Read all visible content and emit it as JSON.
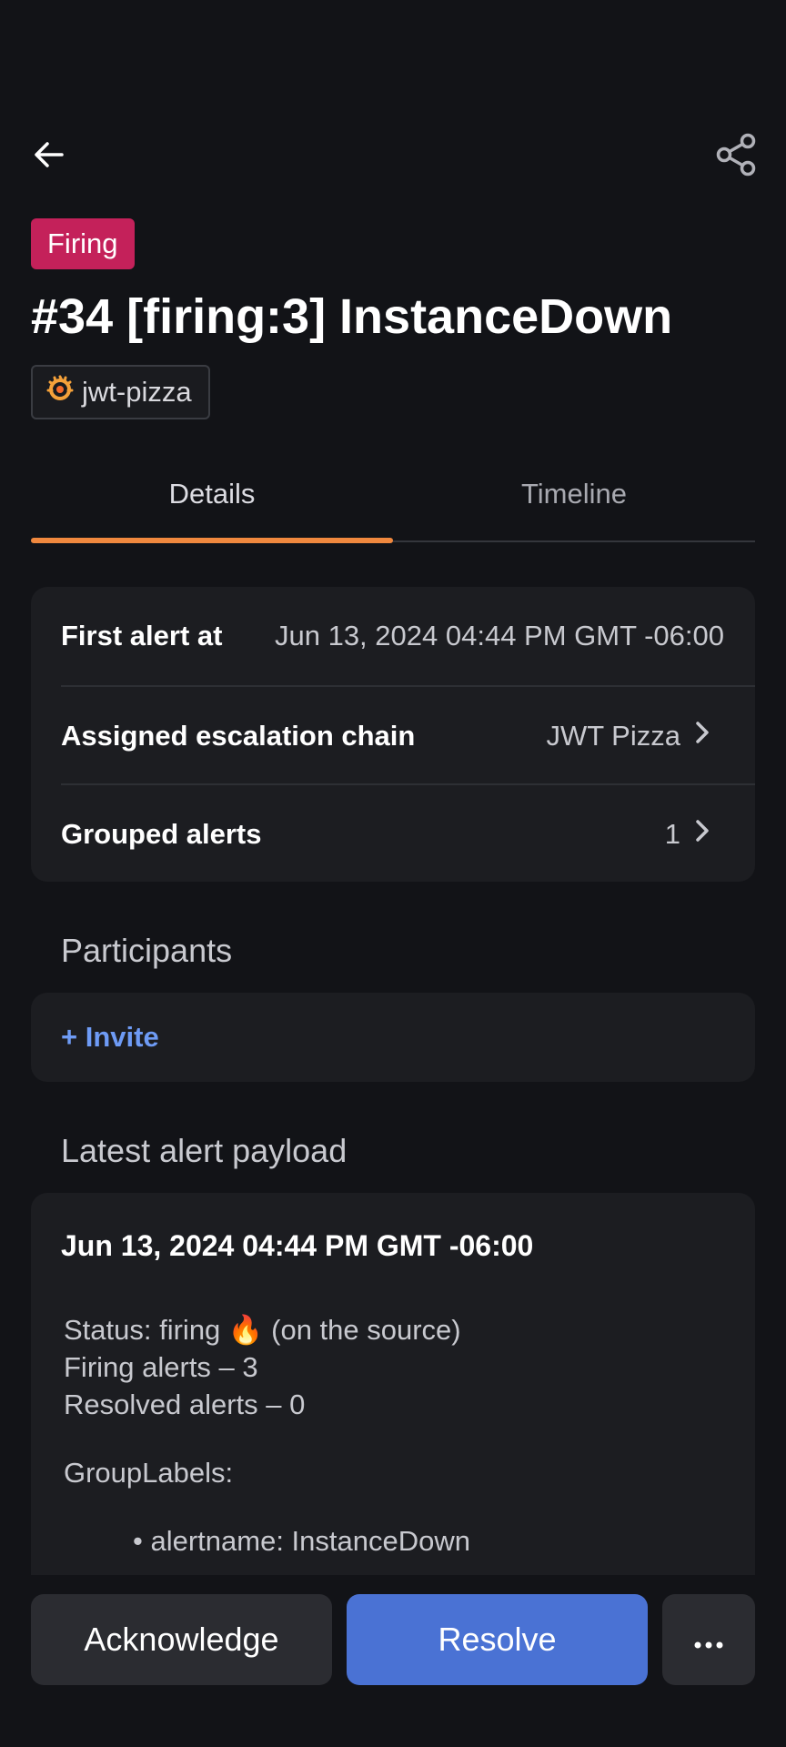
{
  "header": {
    "back_icon": "arrow-left-icon",
    "share_icon": "share-icon"
  },
  "alert": {
    "status_badge": "Firing",
    "status_color": "#c4215a",
    "title": "#34 [firing:3] InstanceDown",
    "source_icon": "grafana-icon",
    "source_name": "jwt-pizza"
  },
  "tabs": [
    {
      "label": "Details",
      "active": true
    },
    {
      "label": "Timeline",
      "active": false
    }
  ],
  "accent_color": "#f0883e",
  "details": {
    "first_alert_label": "First alert at",
    "first_alert_value": "Jun 13, 2024 04:44 PM GMT -06:00",
    "escalation_label": "Assigned escalation chain",
    "escalation_value": "JWT Pizza",
    "grouped_label": "Grouped alerts",
    "grouped_value": "1"
  },
  "participants": {
    "title": "Participants",
    "invite_label": "+ Invite"
  },
  "payload": {
    "title": "Latest alert payload",
    "date": "Jun 13, 2024 04:44 PM GMT -06:00",
    "status_line": "Status: firing 🔥 (on the source)",
    "firing_line": "Firing alerts – 3",
    "resolved_line": "Resolved alerts – 0",
    "group_labels": "GroupLabels:",
    "label_item": "alertname: InstanceDown"
  },
  "actions": {
    "acknowledge": "Acknowledge",
    "resolve": "Resolve",
    "more_icon": "more-horizontal-icon"
  }
}
